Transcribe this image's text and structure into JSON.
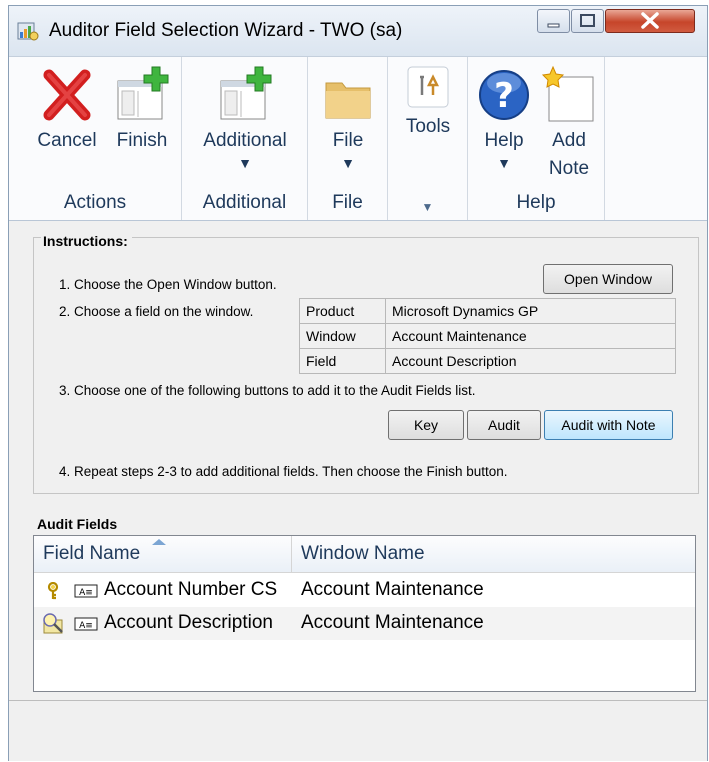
{
  "window": {
    "title": "Auditor Field Selection Wizard  -  TWO (sa)"
  },
  "ribbon": {
    "groups": [
      {
        "label": "Actions"
      },
      {
        "label": "Additional"
      },
      {
        "label": "File"
      },
      {
        "label": ""
      },
      {
        "label": "Help"
      }
    ],
    "buttons": {
      "cancel": "Cancel",
      "finish": "Finish",
      "additional": "Additional",
      "file": "File",
      "tools": "Tools",
      "help": "Help",
      "add_note": "Add Note"
    }
  },
  "instructions": {
    "title": "Instructions:",
    "step1": "1. Choose the Open Window button.",
    "step2": "2. Choose a field on the window.",
    "step3": "3. Choose one of the following buttons to add it to the Audit Fields list.",
    "step4": "4. Repeat steps 2-3 to add additional fields.  Then choose the Finish button.",
    "open_window_button": "Open Window",
    "info": [
      {
        "key": "Product",
        "value": "Microsoft Dynamics GP"
      },
      {
        "key": "Window",
        "value": "Account Maintenance"
      },
      {
        "key": "Field",
        "value": "Account Description"
      }
    ],
    "buttons": {
      "key": "Key",
      "audit": "Audit",
      "audit_with_note": "Audit with Note"
    }
  },
  "audit_fields": {
    "title": "Audit Fields",
    "columns": [
      "Field Name",
      "Window Name"
    ],
    "rows": [
      {
        "icon": "key-icon",
        "type_icon": "string-field-icon",
        "field": "Account Number CS",
        "window": "Account Maintenance"
      },
      {
        "icon": "audit-note-icon",
        "type_icon": "string-field-icon",
        "field": "Account Description",
        "window": "Account Maintenance"
      }
    ]
  },
  "colors": {
    "ribbon_text": "#1e395b",
    "close_button": "#c6452a",
    "accent": "#3c7fb1"
  }
}
